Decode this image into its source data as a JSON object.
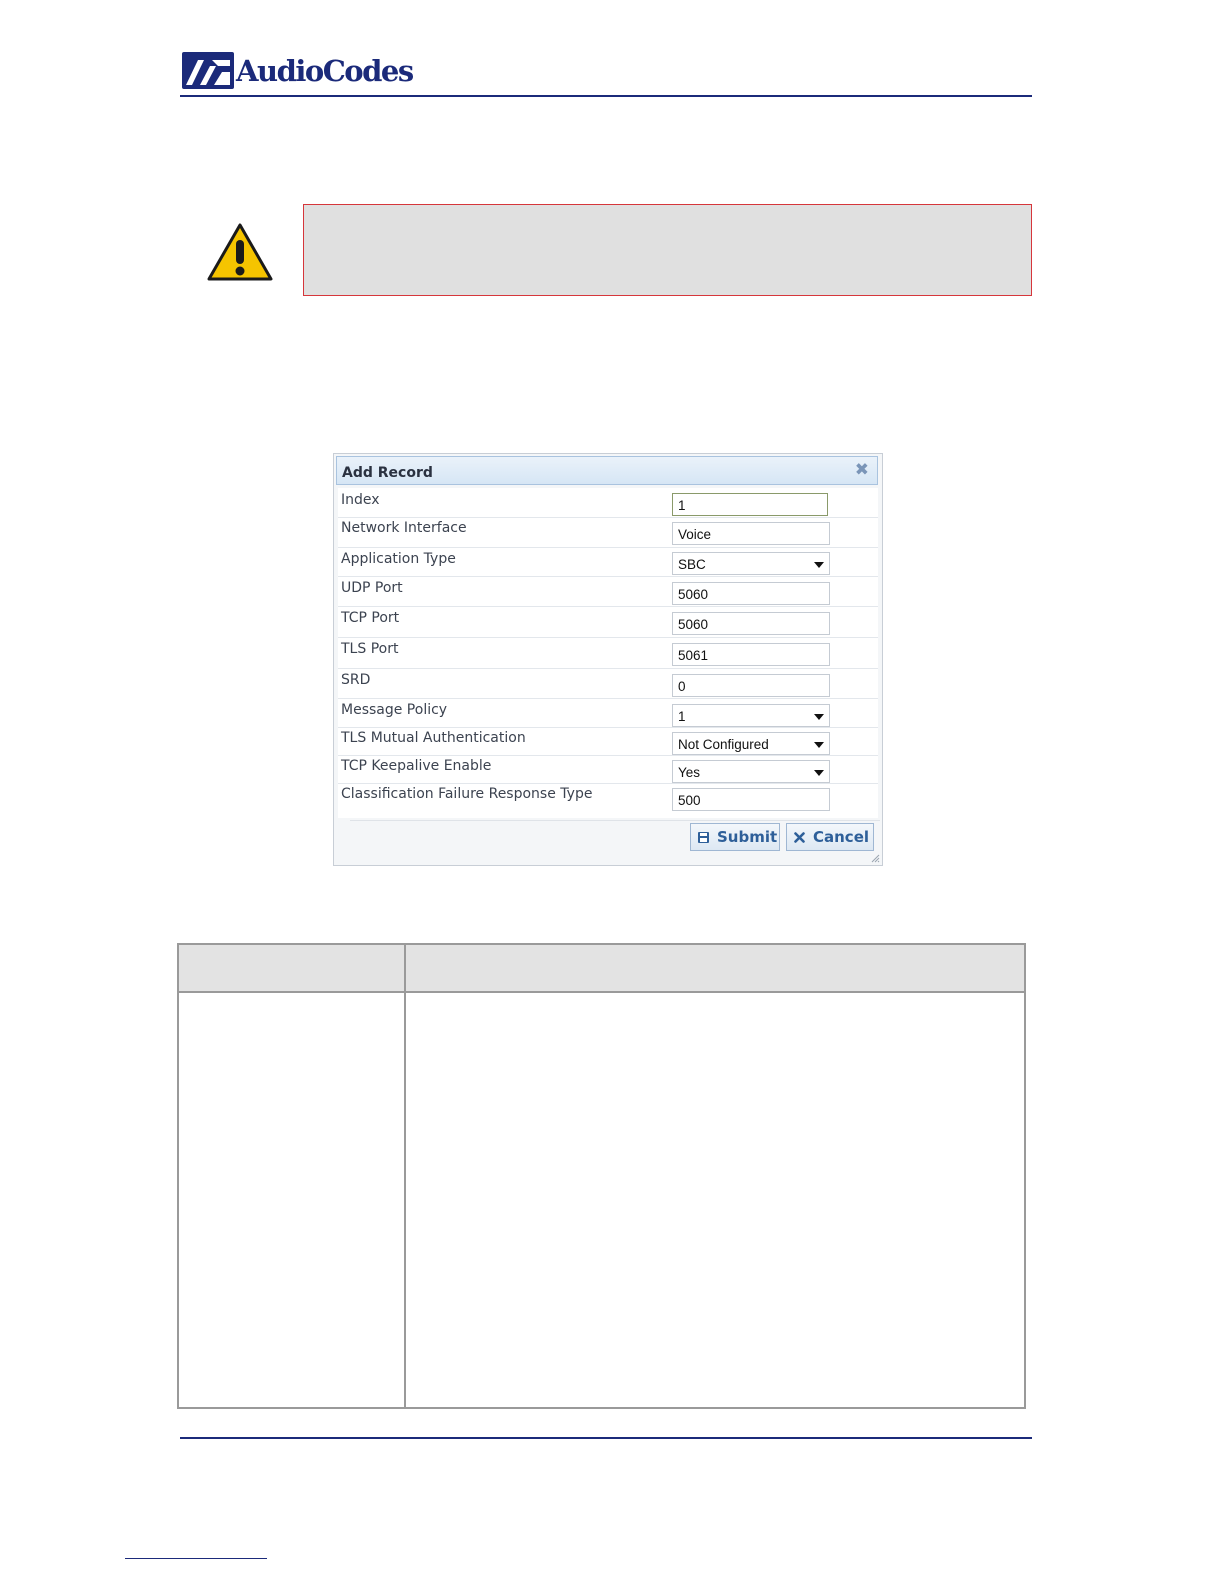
{
  "header": {
    "logo_text": "AudioCodes"
  },
  "dialog": {
    "title": "Add Record",
    "fields": [
      {
        "label": "Index",
        "value": "1",
        "type": "text"
      },
      {
        "label": "Network Interface",
        "value": "Voice",
        "type": "text"
      },
      {
        "label": "Application Type",
        "value": "SBC",
        "type": "select"
      },
      {
        "label": "UDP Port",
        "value": "5060",
        "type": "text"
      },
      {
        "label": "TCP Port",
        "value": "5060",
        "type": "text"
      },
      {
        "label": "TLS Port",
        "value": "5061",
        "type": "text"
      },
      {
        "label": "SRD",
        "value": "0",
        "type": "text"
      },
      {
        "label": "Message Policy",
        "value": "1",
        "type": "select"
      },
      {
        "label": "TLS Mutual Authentication",
        "value": "Not Configured",
        "type": "select"
      },
      {
        "label": "TCP Keepalive Enable",
        "value": "Yes",
        "type": "select"
      },
      {
        "label": "Classification Failure Response Type",
        "value": "500",
        "type": "text"
      }
    ],
    "submit_label": "Submit",
    "cancel_label": "Cancel"
  },
  "colors": {
    "brand": "#1b2a7a",
    "note_border": "#d6363b",
    "button_text": "#2e5f99"
  },
  "icons": {
    "warning": "warning-triangle-icon",
    "close": "close-icon",
    "submit": "save-icon",
    "cancel": "x-icon"
  }
}
